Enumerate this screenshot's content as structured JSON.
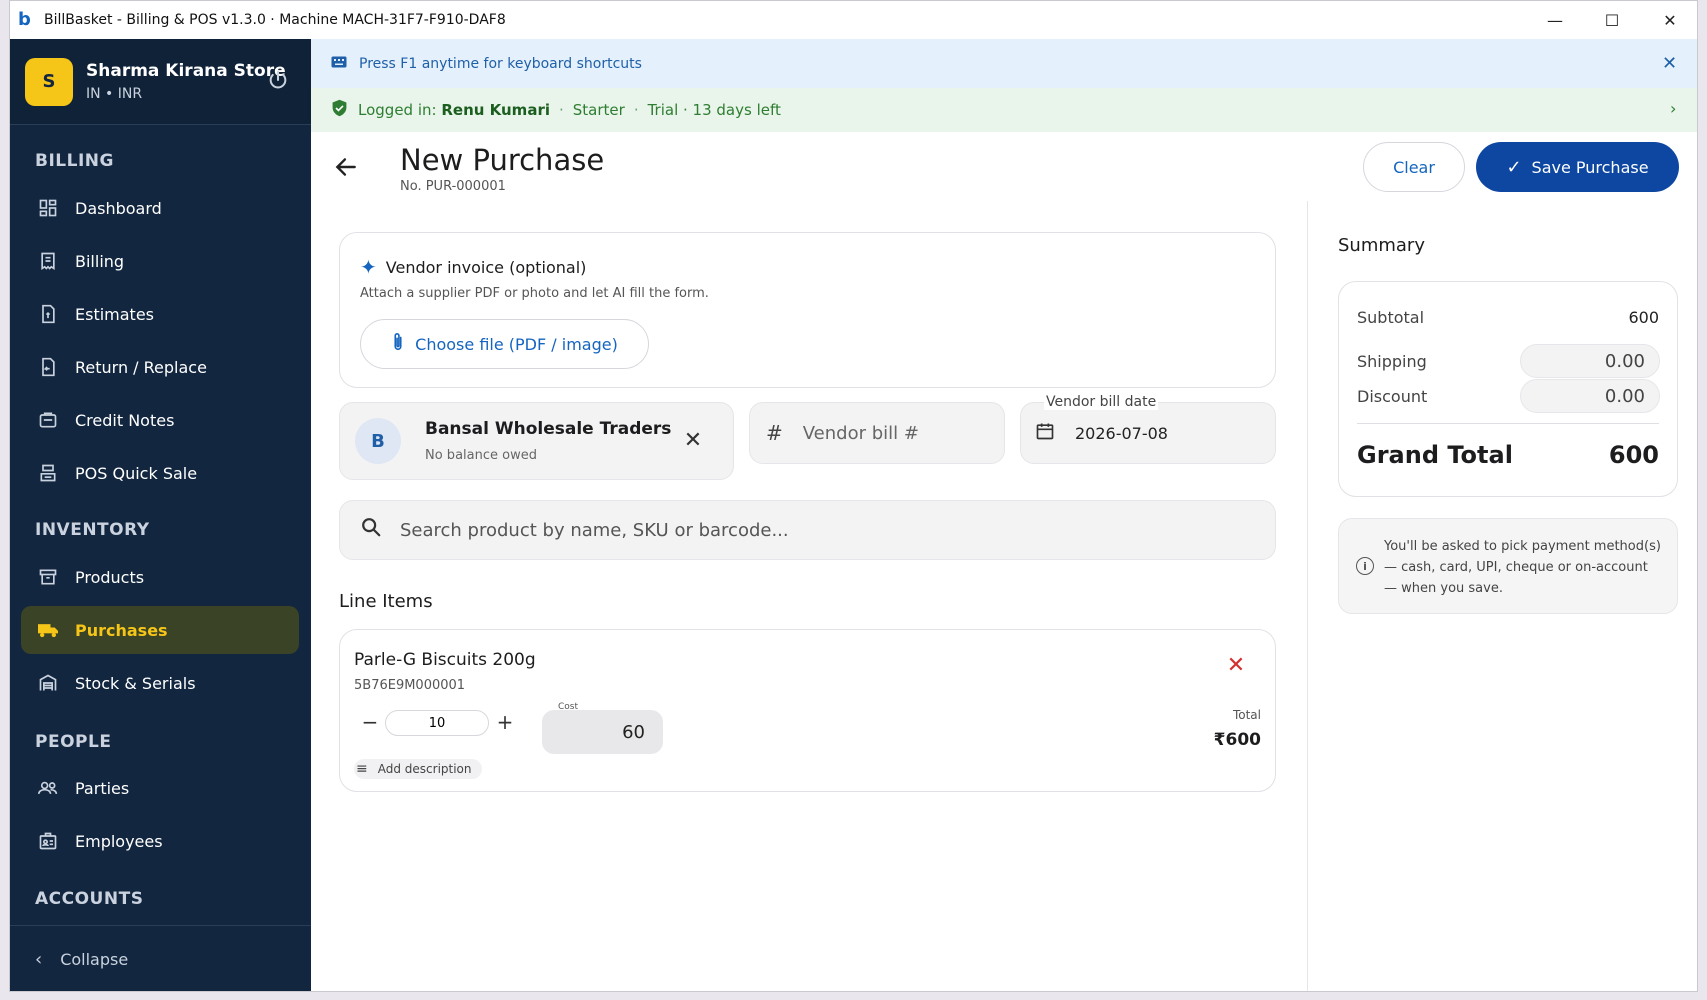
{
  "window": {
    "title": "BillBasket - Billing & POS  v1.3.0  ·  Machine MACH-31F7-F910-DAF8",
    "logo_letter": "b",
    "minimize": "—",
    "maximize": "☐",
    "close": "✕"
  },
  "store": {
    "avatar": "S",
    "name": "Sharma Kirana Store",
    "locale": "IN • INR"
  },
  "sidebar": {
    "sections": [
      {
        "label": "BILLING"
      },
      {
        "label": "INVENTORY"
      },
      {
        "label": "PEOPLE"
      },
      {
        "label": "ACCOUNTS"
      }
    ],
    "items": [
      {
        "label": "Dashboard",
        "icon": "dashboard-icon"
      },
      {
        "label": "Billing",
        "icon": "receipt-icon"
      },
      {
        "label": "Estimates",
        "icon": "estimate-icon"
      },
      {
        "label": "Return / Replace",
        "icon": "return-icon"
      },
      {
        "label": "Credit Notes",
        "icon": "credit-note-icon"
      },
      {
        "label": "POS Quick Sale",
        "icon": "pos-icon"
      },
      {
        "label": "Products",
        "icon": "archive-icon"
      },
      {
        "label": "Purchases",
        "icon": "truck-icon",
        "active": true
      },
      {
        "label": "Stock & Serials",
        "icon": "warehouse-icon"
      },
      {
        "label": "Parties",
        "icon": "people-icon"
      },
      {
        "label": "Employees",
        "icon": "badge-icon"
      }
    ],
    "collapse_label": "Collapse"
  },
  "banners": {
    "keyboard": "Press F1 anytime for keyboard shortcuts",
    "login_prefix": "Logged in:",
    "login_user": "Renu Kumari",
    "plan": "Starter",
    "trial": "Trial · 13 days left"
  },
  "header": {
    "title": "New Purchase",
    "number": "No. PUR-000001",
    "clear_label": "Clear",
    "save_label": "Save Purchase"
  },
  "vendor_invoice": {
    "title": "Vendor invoice (optional)",
    "description": "Attach a supplier PDF or photo and let AI fill the form.",
    "button_label": "Choose file (PDF / image)"
  },
  "vendor": {
    "avatar": "B",
    "name": "Bansal Wholesale Traders",
    "balance": "No balance owed"
  },
  "bill_number": {
    "placeholder": "Vendor bill #",
    "value": ""
  },
  "bill_date": {
    "label": "Vendor bill date",
    "value": "2026-07-08"
  },
  "search": {
    "placeholder": "Search product by name, SKU or barcode..."
  },
  "line_items": {
    "title": "Line Items",
    "items": [
      {
        "name": "Parle-G Biscuits 200g",
        "sku": "5B76E9M000001",
        "qty": "10",
        "cost_label": "Cost",
        "cost": "60",
        "add_description": "Add description",
        "total_label": "Total",
        "total": "₹600"
      }
    ]
  },
  "summary": {
    "title": "Summary",
    "subtotal_label": "Subtotal",
    "subtotal": "600",
    "shipping_label": "Shipping",
    "shipping": "0.00",
    "discount_label": "Discount",
    "discount": "0.00",
    "grand_total_label": "Grand Total",
    "grand_total": "600",
    "payment_note": "You'll be asked to pick payment method(s) — cash, card, UPI, cheque or on-account — when you save."
  },
  "colors": {
    "sidebar_bg": "#12263f",
    "accent_yellow": "#f5c518",
    "primary_blue": "#0d47a1",
    "success_green": "#2e7d32",
    "danger_red": "#d32f2f"
  }
}
